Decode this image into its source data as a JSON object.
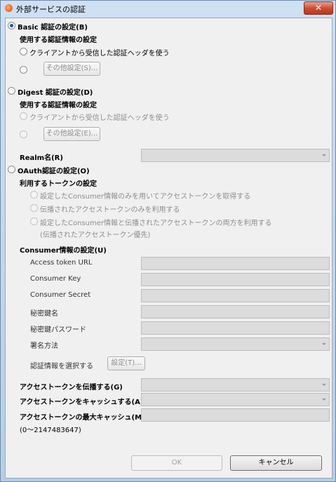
{
  "window": {
    "title": "外部サービスの認証",
    "close_label": "✕"
  },
  "basic": {
    "label": "Basic 認証の設定(B)",
    "sub_heading": "使用する認証情報の設定",
    "option_client_header": "クライアントから受信した認証ヘッダを使う",
    "other_settings_button": "その他設定(S)..."
  },
  "digest": {
    "label": "Digest 認証の設定(D)",
    "sub_heading": "使用する認証情報の設定",
    "option_client_header": "クライアントから受信した認証ヘッダを使う",
    "other_settings_button": "その他設定(E)..."
  },
  "realm": {
    "label": "Realm名(R)",
    "value": ""
  },
  "oauth": {
    "label": "OAuth認証の設定(O)",
    "token_heading": "利用するトークンの設定",
    "option_consumer_only": "設定したConsumer情報のみを用いてアクセストークンを取得する",
    "option_propagated_only": "伝播されたアクセストークンのみを利用する",
    "option_both": "設定したConsumer情報と伝播されたアクセストークンの両方を利用する",
    "option_both_note": "(伝播されたアクセストークン優先)",
    "consumer_heading": "Consumer情報の設定(U)",
    "fields": {
      "access_token_url": "Access token URL",
      "consumer_key": "Consumer Key",
      "consumer_secret": "Consumer Secret",
      "private_key_name": "秘密鍵名",
      "private_key_password": "秘密鍵パスワード",
      "signature_method": "署名方法"
    },
    "select_credentials_label": "認証情報を選択する",
    "select_credentials_button": "設定(T)...",
    "propagate_token_label": "アクセストークンを伝播する(G)",
    "cache_token_label": "アクセストークンをキャッシュする(A)",
    "max_cache_label": "アクセストークンの最大キャッシュ(M)",
    "max_cache_range": "(0～2147483647)"
  },
  "footer": {
    "ok_label": "OK",
    "cancel_label": "キャンセル"
  },
  "state": {
    "basic_selected": true,
    "basic_client_header_selected": false,
    "digest_selected": false,
    "oauth_selected": false
  }
}
